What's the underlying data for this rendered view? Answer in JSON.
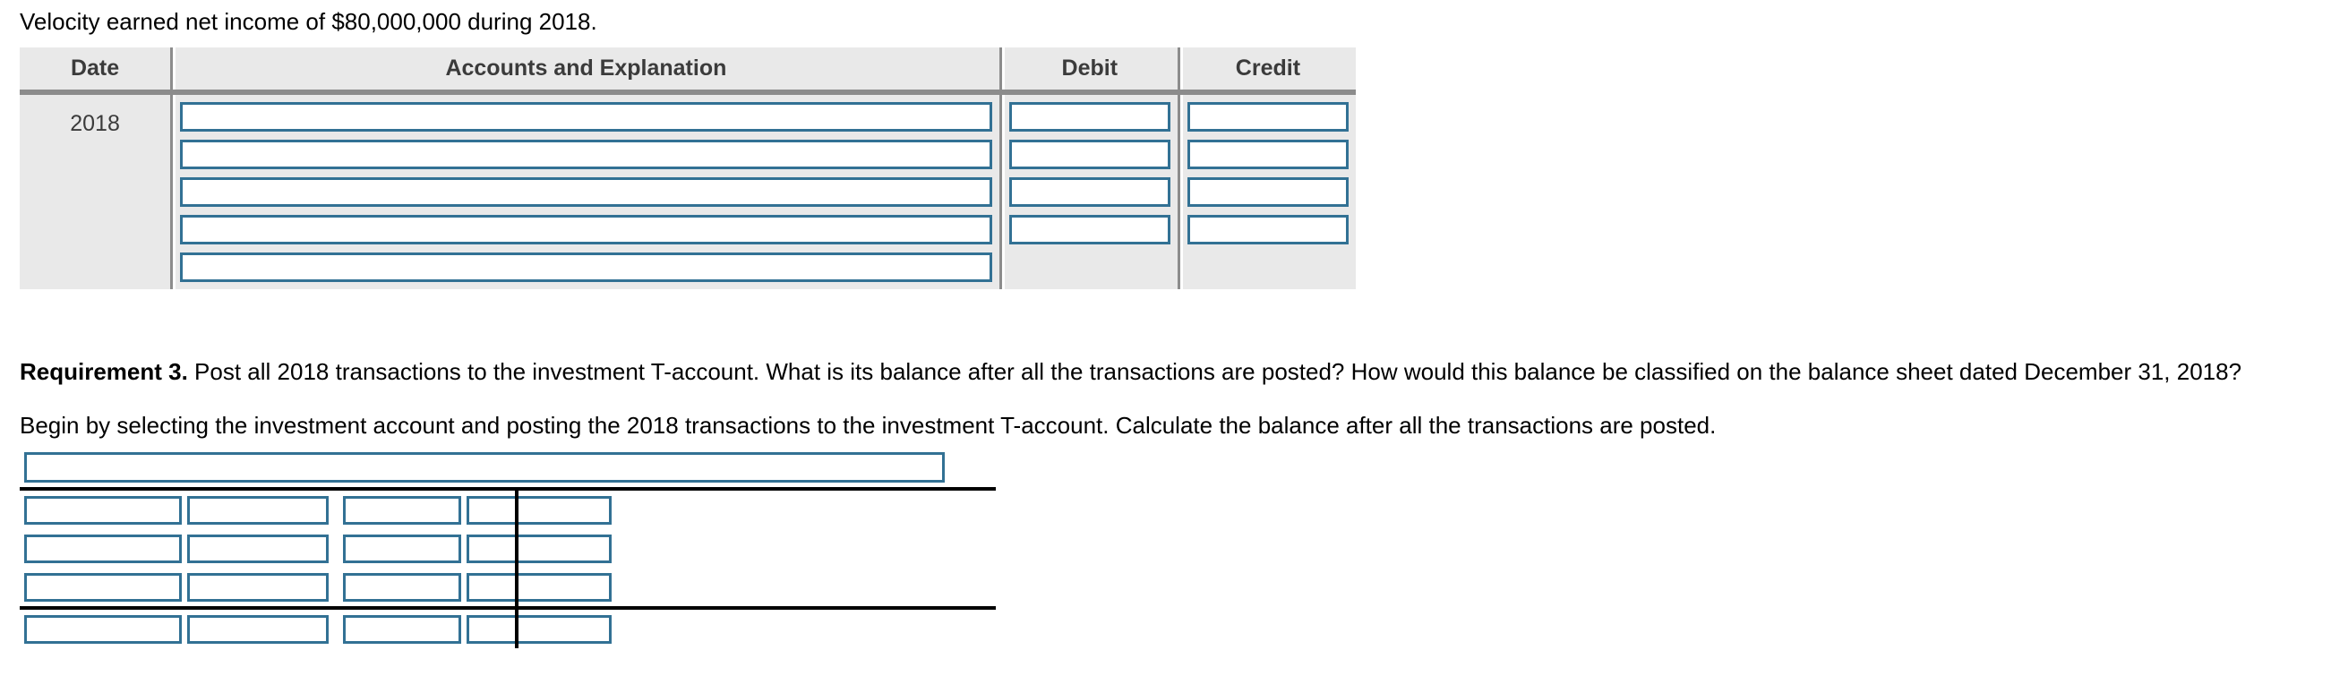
{
  "intro": {
    "text": "Velocity earned net income of $80,000,000 during 2018."
  },
  "journal": {
    "headers": {
      "date": "Date",
      "accounts": "Accounts and Explanation",
      "debit": "Debit",
      "credit": "Credit"
    },
    "date_value": "2018",
    "accounts_rows": [
      "",
      "",
      "",
      "",
      ""
    ],
    "debit_rows": [
      "",
      "",
      "",
      ""
    ],
    "credit_rows": [
      "",
      "",
      "",
      ""
    ]
  },
  "requirement": {
    "label": "Requirement 3.",
    "text": " Post all 2018 transactions to the investment T-account. What is its balance after all the transactions are posted? How would this balance be classified on the balance sheet dated December 31, 2018?",
    "instruction": "Begin by selecting the investment account and posting the 2018 transactions to the investment T-account. Calculate the balance after all the transactions are posted."
  },
  "taccount": {
    "title_value": "",
    "rows": [
      [
        "",
        "",
        "",
        ""
      ],
      [
        "",
        "",
        "",
        ""
      ],
      [
        "",
        "",
        "",
        ""
      ]
    ],
    "balance_row": [
      "",
      "",
      "",
      ""
    ]
  },
  "colors": {
    "input_border": "#327194",
    "table_header_bg": "#e9e9e9",
    "table_rule": "#8c8c8c",
    "heavy_rule": "#000000",
    "text": "#000000",
    "header_text": "#3b3b3b"
  }
}
